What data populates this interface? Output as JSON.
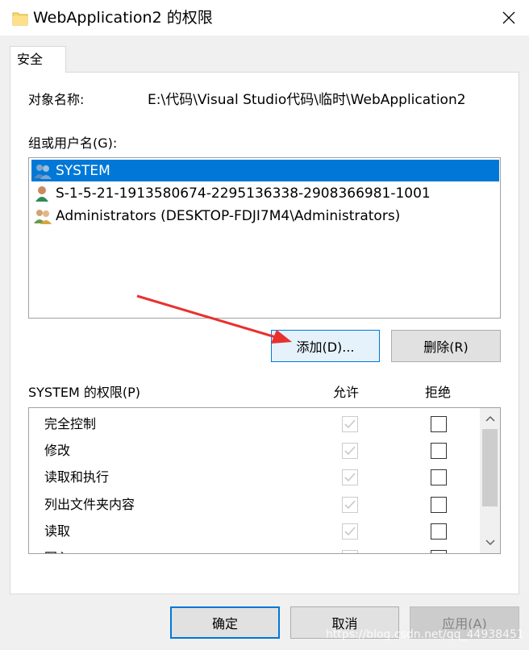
{
  "window": {
    "title": "WebApplication2 的权限"
  },
  "tabs": [
    {
      "label": "安全"
    }
  ],
  "object": {
    "label": "对象名称:",
    "path": "E:\\代码\\Visual Studio代码\\临时\\WebApplication2"
  },
  "groups": {
    "label": "组或用户名(G):",
    "items": [
      {
        "name": "SYSTEM",
        "icon": "group-users-icon",
        "selected": true
      },
      {
        "name": "S-1-5-21-1913580674-2295136338-2908366981-1001",
        "icon": "unknown-user-icon",
        "selected": false
      },
      {
        "name": "Administrators (DESKTOP-FDJI7M4\\Administrators)",
        "icon": "group-users-icon",
        "selected": false
      }
    ]
  },
  "buttons": {
    "add": "添加(D)...",
    "remove": "删除(R)",
    "ok": "确定",
    "cancel": "取消",
    "apply": "应用(A)"
  },
  "permissions": {
    "label": "SYSTEM 的权限(P)",
    "allow_header": "允许",
    "deny_header": "拒绝",
    "items": [
      {
        "name": "完全控制",
        "allow": true,
        "deny": false
      },
      {
        "name": "修改",
        "allow": true,
        "deny": false
      },
      {
        "name": "读取和执行",
        "allow": true,
        "deny": false
      },
      {
        "name": "列出文件夹内容",
        "allow": true,
        "deny": false
      },
      {
        "name": "读取",
        "allow": true,
        "deny": false
      },
      {
        "name": "写入",
        "allow": true,
        "deny": false
      }
    ]
  },
  "watermark": "https://blog.csdn.net/qq_44938451",
  "colors": {
    "accent": "#0078d7",
    "arrow": "#e8312f",
    "folder": "#f8d775"
  }
}
